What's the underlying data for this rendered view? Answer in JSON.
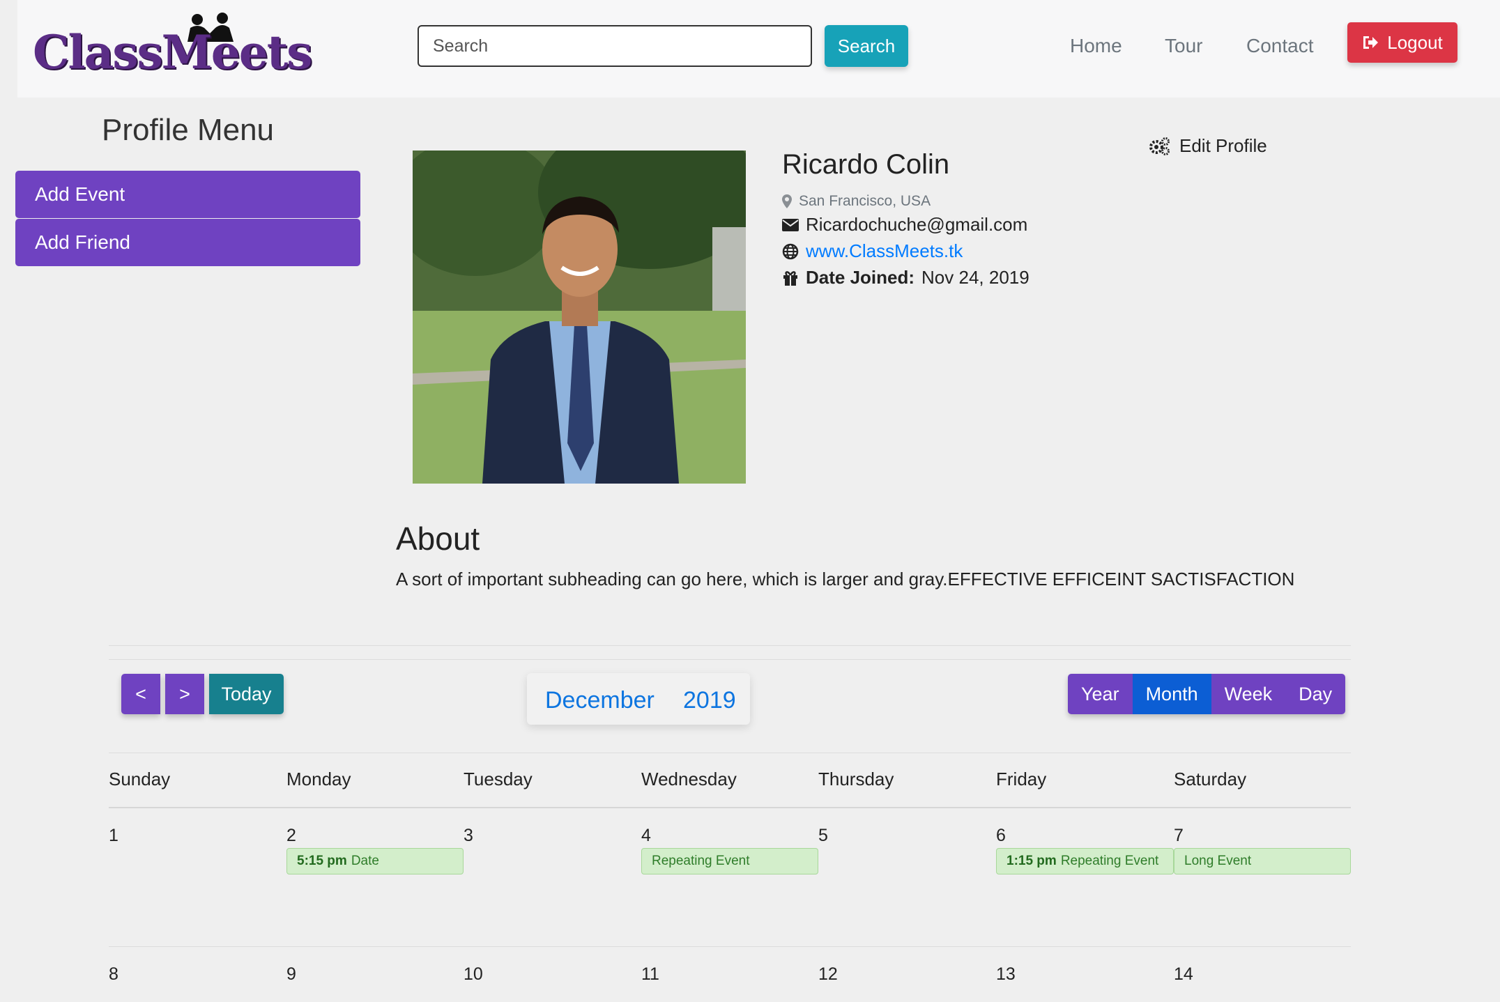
{
  "header": {
    "logo_text": "ClassMeets",
    "search_placeholder": "Search",
    "search_button": "Search",
    "nav": [
      "Home",
      "Tour",
      "Contact"
    ],
    "logout": "Logout"
  },
  "sidebar": {
    "title": "Profile Menu",
    "items": [
      {
        "label": "Add Event"
      },
      {
        "label": "Add Friend"
      }
    ]
  },
  "profile": {
    "name": "Ricardo Colin",
    "location": "San Francisco, USA",
    "email": "Ricardochuche@gmail.com",
    "website": "www.ClassMeets.tk",
    "date_joined_label": "Date Joined:",
    "date_joined": "Nov 24, 2019",
    "edit_label": "Edit Profile"
  },
  "about": {
    "title": "About",
    "text": "A sort of important subheading can go here, which is larger and gray.EFFECTIVE EFFICEINT SACTISFACTION"
  },
  "calendar": {
    "prev": "<",
    "next": ">",
    "today": "Today",
    "month": "December",
    "year": "2019",
    "views": [
      "Year",
      "Month",
      "Week",
      "Day"
    ],
    "active_view": "Month",
    "weekdays": [
      "Sunday",
      "Monday",
      "Tuesday",
      "Wednesday",
      "Thursday",
      "Friday",
      "Saturday"
    ],
    "week1_days": [
      "1",
      "2",
      "3",
      "4",
      "5",
      "6",
      "7"
    ],
    "week2_days": [
      "8",
      "9",
      "10",
      "11",
      "12",
      "13",
      "14"
    ],
    "events": [
      {
        "time": "5:15 pm",
        "title": "Date"
      },
      {
        "time": "",
        "title": "Repeating Event"
      },
      {
        "time": "1:15 pm",
        "title": "Repeating Event"
      },
      {
        "time": "",
        "title": "Long Event"
      }
    ]
  },
  "colors": {
    "brand_purple": "#6f42c1",
    "search_teal": "#17a2b8",
    "logout_red": "#dc3545",
    "active_view_blue": "#0c5ed4",
    "event_green": "#d3eecb"
  }
}
